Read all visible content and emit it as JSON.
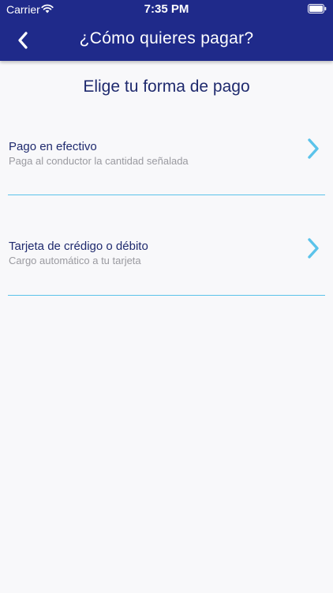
{
  "status_bar": {
    "carrier": "Carrier",
    "time": "7:35 PM"
  },
  "nav": {
    "title": "¿Cómo quieres pagar?",
    "back_icon": "chevron-left-icon"
  },
  "main": {
    "heading": "Elige tu forma de pago",
    "options": [
      {
        "title": "Pago en efectivo",
        "subtitle": "Paga al conductor la cantidad señalada",
        "icon": "chevron-right-icon"
      },
      {
        "title": "Tarjeta de crédigo o débito",
        "subtitle": "Cargo automático a tu tarjeta",
        "icon": "chevron-right-icon"
      }
    ]
  },
  "colors": {
    "header_bg": "#1f2a8a",
    "title_text": "#1f2a6e",
    "subtitle_text": "#9a9aa0",
    "accent": "#5bc3ea",
    "background": "#f8f8fa"
  }
}
